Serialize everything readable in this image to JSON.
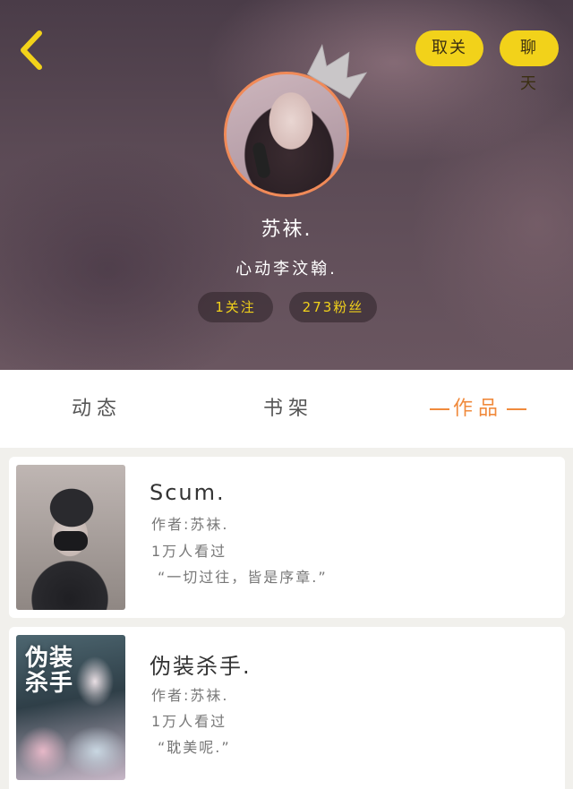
{
  "header": {
    "unfollow_label": "取关",
    "chat_label": "聊天",
    "nickname": "苏袜.",
    "signature": "心动李汶翰.",
    "following": "1关注",
    "fans": "273粉丝"
  },
  "tabs": {
    "dynamic": "动态",
    "shelf": "书架",
    "works": "作品"
  },
  "works": [
    {
      "title": "Scum.",
      "author": "作者:苏袜.",
      "views": "1万人看过",
      "quote": "“一切过往，皆是序章.”"
    },
    {
      "title": "伪装杀手.",
      "cover_text": "伪装杀手",
      "author": "作者:苏袜.",
      "views": "1万人看过",
      "quote": "“耽美呢.”"
    }
  ],
  "colors": {
    "accent_yellow": "#f2d21a",
    "accent_orange": "#f08a3c",
    "avatar_border": "#f08a58"
  },
  "icons": {
    "back": "chevron-left-icon",
    "crown": "crown-icon"
  }
}
